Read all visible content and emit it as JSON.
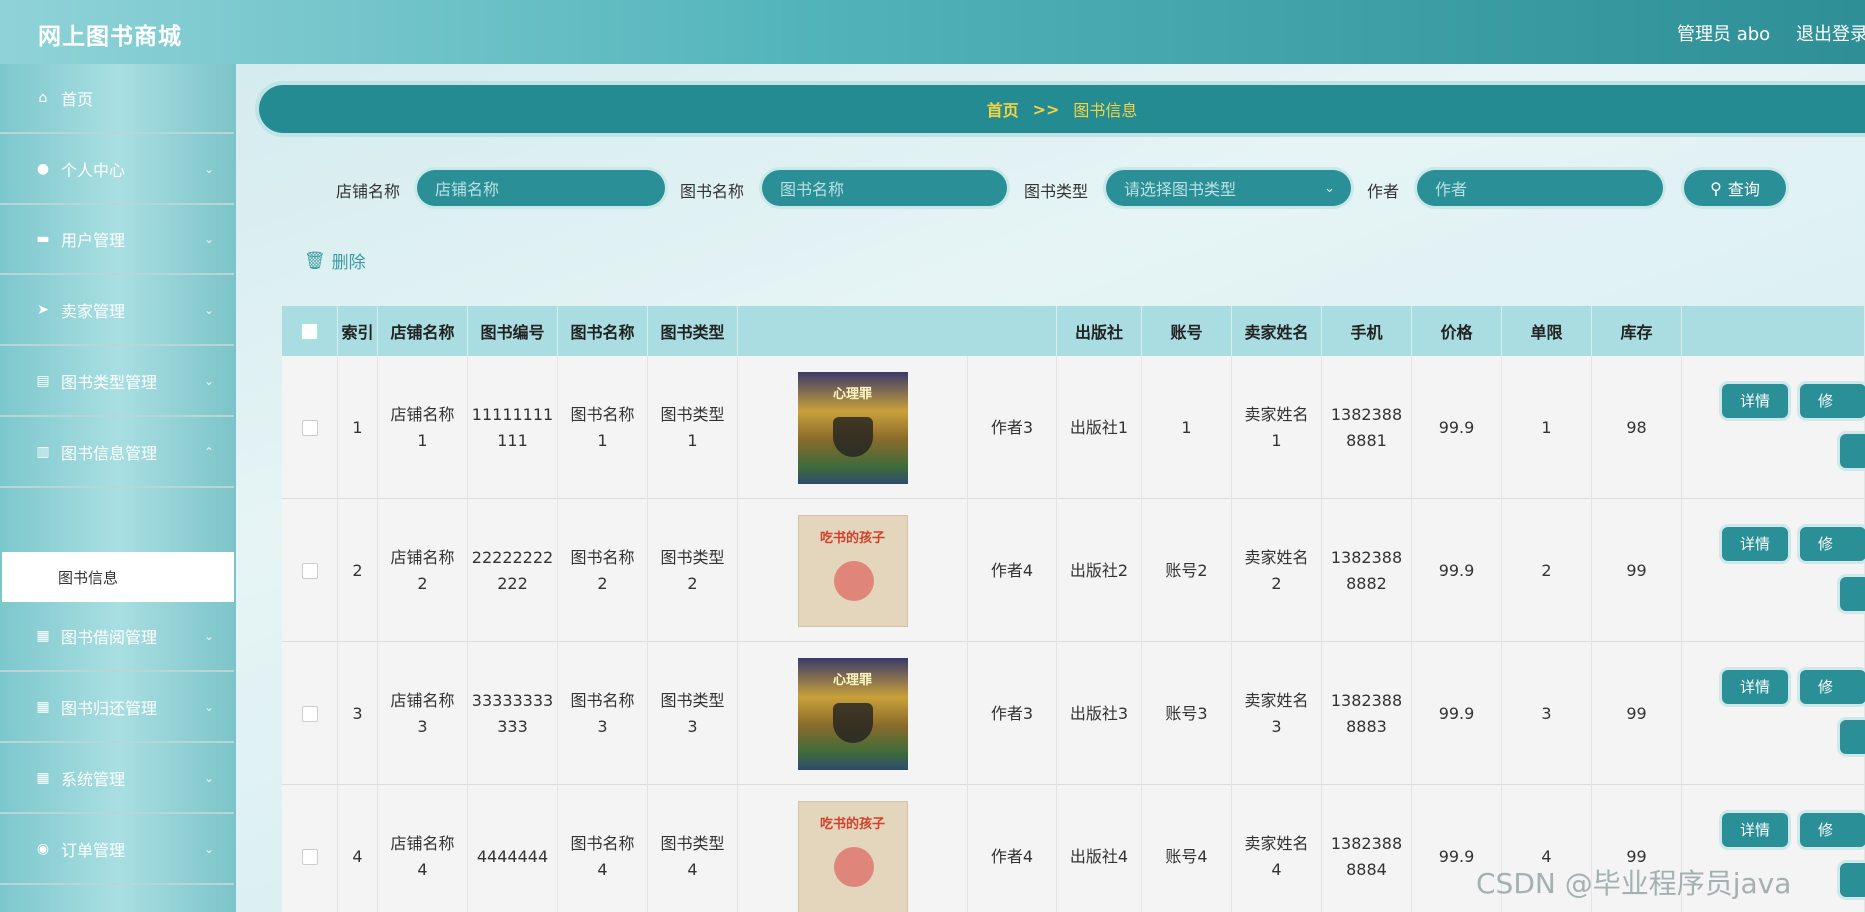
{
  "header": {
    "brand": "网上图书商城",
    "admin": "管理员 abo",
    "logout": "退出登录"
  },
  "sidebar": {
    "items": [
      {
        "label": "首页",
        "icon": "home-icon",
        "glyph": "⌂",
        "chev": ""
      },
      {
        "label": "个人中心",
        "icon": "user-icon",
        "glyph": "●",
        "chev": "⌄"
      },
      {
        "label": "用户管理",
        "icon": "monitor-icon",
        "glyph": "▬",
        "chev": "⌄"
      },
      {
        "label": "卖家管理",
        "icon": "send-icon",
        "glyph": "➤",
        "chev": "⌄"
      },
      {
        "label": "图书类型管理",
        "icon": "clipboard-icon",
        "glyph": "▤",
        "chev": "⌄"
      },
      {
        "label": "图书信息管理",
        "icon": "chart-icon",
        "glyph": "▥",
        "chev": "⌃"
      },
      {
        "label": "图书借阅管理",
        "icon": "grid-icon",
        "glyph": "▦",
        "chev": "⌄"
      },
      {
        "label": "图书归还管理",
        "icon": "apps-icon",
        "glyph": "▦",
        "chev": "⌄"
      },
      {
        "label": "系统管理",
        "icon": "apps-icon",
        "glyph": "▦",
        "chev": "⌄"
      },
      {
        "label": "订单管理",
        "icon": "bulb-icon",
        "glyph": "◉",
        "chev": "⌄"
      }
    ],
    "sub_item": "图书信息"
  },
  "breadcrumb": {
    "home": "首页",
    "sep": ">>",
    "current": "图书信息"
  },
  "search": {
    "shop_label": "店铺名称",
    "shop_placeholder": "店铺名称",
    "book_label": "图书名称",
    "book_placeholder": "图书名称",
    "type_label": "图书类型",
    "type_placeholder": "请选择图书类型",
    "author_label": "作者",
    "author_placeholder": "作者",
    "query": "查询"
  },
  "delete_label": "删除",
  "table": {
    "headers": [
      "索引",
      "店铺名称",
      "图书编号",
      "图书名称",
      "图书类型",
      "出版社",
      "账号",
      "卖家姓名",
      "手机",
      "价格",
      "单限",
      "库存"
    ],
    "rows": [
      {
        "idx": "1",
        "shop": [
          "店铺名称",
          "1"
        ],
        "no": [
          "11111111",
          "111"
        ],
        "name": [
          "图书名称",
          "1"
        ],
        "type": [
          "图书类型",
          "1"
        ],
        "cover": "a",
        "cover_title": "心理罪",
        "author": "作者3",
        "pub": "出版社1",
        "acct": "1",
        "seller": [
          "卖家姓名",
          "1"
        ],
        "phone": [
          "1382388",
          "8881"
        ],
        "price": "99.9",
        "limit": "1",
        "stock": "98"
      },
      {
        "idx": "2",
        "shop": [
          "店铺名称",
          "2"
        ],
        "no": [
          "22222222",
          "222"
        ],
        "name": [
          "图书名称",
          "2"
        ],
        "type": [
          "图书类型",
          "2"
        ],
        "cover": "b",
        "cover_title": "吃书的孩子",
        "author": "作者4",
        "pub": "出版社2",
        "acct": "账号2",
        "seller": [
          "卖家姓名",
          "2"
        ],
        "phone": [
          "1382388",
          "8882"
        ],
        "price": "99.9",
        "limit": "2",
        "stock": "99"
      },
      {
        "idx": "3",
        "shop": [
          "店铺名称",
          "3"
        ],
        "no": [
          "33333333",
          "333"
        ],
        "name": [
          "图书名称",
          "3"
        ],
        "type": [
          "图书类型",
          "3"
        ],
        "cover": "a",
        "cover_title": "心理罪",
        "author": "作者3",
        "pub": "出版社3",
        "acct": "账号3",
        "seller": [
          "卖家姓名",
          "3"
        ],
        "phone": [
          "1382388",
          "8883"
        ],
        "price": "99.9",
        "limit": "3",
        "stock": "99"
      },
      {
        "idx": "4",
        "shop": [
          "店铺名称",
          "4"
        ],
        "no": [
          "4444444",
          ""
        ],
        "name": [
          "图书名称",
          "4"
        ],
        "type": [
          "图书类型",
          "4"
        ],
        "cover": "b",
        "cover_title": "吃书的孩子",
        "author": "作者4",
        "pub": "出版社4",
        "acct": "账号4",
        "seller": [
          "卖家姓名",
          "4"
        ],
        "phone": [
          "1382388",
          "8884"
        ],
        "price": "99.9",
        "limit": "4",
        "stock": "99"
      }
    ],
    "detail_btn": "详情",
    "edit_btn": "修"
  },
  "watermark": "CSDN @毕业程序员java",
  "colors": {
    "accent": "#2a8f96",
    "breadcrumb_text": "#f5d442",
    "header_bg": "#258b93"
  }
}
